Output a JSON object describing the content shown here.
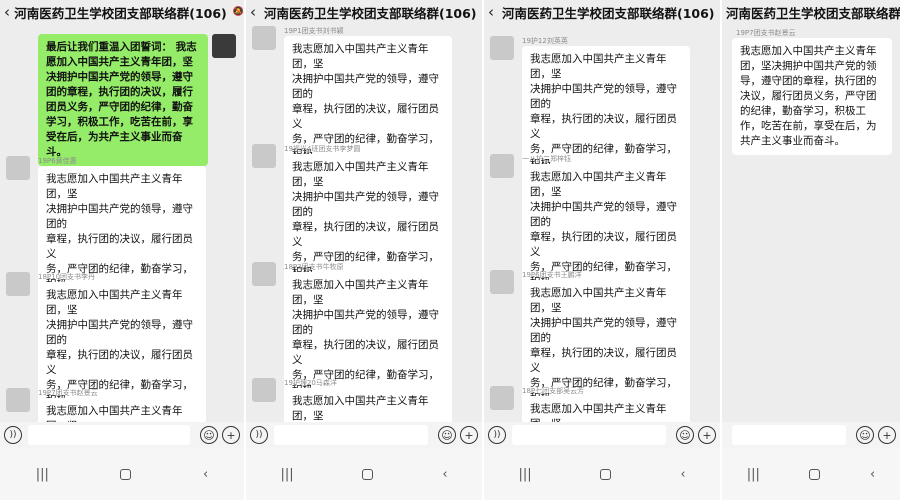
{
  "group_title": "河南医药卫生学校团支部联络群(106)",
  "back_glyph": "‹",
  "mute_glyph": "🔕",
  "icons": {
    "voice": "voice-icon",
    "emoji": "emoji-icon",
    "plus": "plus-icon",
    "recent": "recent-apps-icon",
    "home": "home-icon",
    "back": "back-nav-icon"
  },
  "colors": {
    "mine_bubble": "#95ec69",
    "bg": "#ededed"
  },
  "oath_full": "我志愿加入中国共产主义青年团，坚决拥护中国共产党的领导，遵守团的章程，执行团的决议，履行团员义务，严守团的纪律，勤奋学习，积极工作，吃苦在前，享受在后，为共产主义事业而奋斗。",
  "panels": [
    {
      "mine_message": "最后让我们重温入团誓词：    我志愿加入中国共产主义青年团，坚决拥护中国共产党的领导，遵守团的章程，执行团的决议，履行团员义务，严守团的纪律，勤奋学习，积极工作，吃苦在前，享受在后，为共产主义事业而奋斗。",
      "messages": [
        {
          "sender": "19P6黄佳惠",
          "text": "我志愿加入中国共产主义青年团，坚\n决拥护中国共产党的领导，遵守团的\n章程，执行团的决议，履行团员义\n务，严守团的纪律，勤奋学习，积极\n工作，吃苦在前，享受在后，为共产\n主义事业而奋斗。"
        },
        {
          "sender": "18P10团支书李丹",
          "text": "我志愿加入中国共产主义青年团，坚\n决拥护中国共产党的领导，遵守团的\n章程，执行团的决议，履行团员义\n务，严守团的纪律，勤奋学习，积极\n工作，吃苦在前，享受在后，为共产\n主义事业而奋斗。"
        },
        {
          "sender": "19P7团支书赵景云",
          "text": "我志愿加入中国共产主义青年团，坚"
        }
      ]
    },
    {
      "messages": [
        {
          "sender": "19P1团支书刘书颖",
          "text": "我志愿加入中国共产主义青年团，坚\n决拥护中国共产党的领导，遵守团的\n章程，执行团的决议，履行团员义\n务，严守团的纪律，勤奋学习，积极\n工作，吃苦在前，享受在后，为共产\n主义事业而奋斗。"
        },
        {
          "sender": "19视光4班团支书李梦圆",
          "text": "我志愿加入中国共产主义青年团，坚\n决拥护中国共产党的领导，遵守团的\n章程，执行团的决议，履行团员义\n务，严守团的纪律，勤奋学习，积极\n工作，吃苦在前，享受在后，为共产\n主义事业而奋斗。"
        },
        {
          "sender": "18P3团支书牛牧原",
          "text": "我志愿加入中国共产主义青年团，坚\n决拥护中国共产党的领导，遵守团的\n章程，执行团的决议，履行团员义\n务，严守团的纪律，勤奋学习，积极\n工作，吃苦在前，享受在后，为共产\n主义事业而奋斗。"
        },
        {
          "sender": "19护理20马森洋",
          "text": "我志愿加入中国共产主义青年团，坚\n决拥护中国共产党的领导，遵守团的"
        }
      ]
    },
    {
      "messages": [
        {
          "sender": "19护12刘英英",
          "text": "我志愿加入中国共产主义青年团，坚\n决拥护中国共产党的领导，遵守团的\n章程，执行团的决议，履行团员义\n务，严守团的纪律，勤奋学习，积极\n工作，吃苦在前，享受在后，为共产\n主义事业而奋斗。"
        },
        {
          "sender": "一八护二郑梓钰",
          "text": "我志愿加入中国共产主义青年团，坚\n决拥护中国共产党的领导，遵守团的\n章程，执行团的决议，履行团员义\n务，严守团的纪律，勤奋学习，积极\n工作，吃苦在前，享受在后，为共产\n主义事业而奋斗。"
        },
        {
          "sender": "19P6团支书王鹏洋",
          "text": "我志愿加入中国共产主义青年团，坚\n决拥护中国共产党的领导，遵守团的\n章程，执行团的决议，履行团员义\n务，严守团的纪律，勤奋学习，积极\n工作，吃苦在前，享受在后，为共产\n主义事业而奋斗。"
        },
        {
          "sender": "18P七团支部吴云芳",
          "text": "我志愿加入中国共产主义青年团，坚"
        }
      ]
    },
    {
      "messages": [
        {
          "sender": "19P7团支书赵景云",
          "text": "我志愿加入中国共产主\n义青年团，坚决拥护中\n国共产党的领导，遵守\n团的章程，执行团的决\n议，履行团员义务，严\n守团的纪律，勤奋学\n习，积极工作，吃苦在\n前，享受在后，为共产\n主义事业而奋斗。"
        }
      ]
    }
  ]
}
